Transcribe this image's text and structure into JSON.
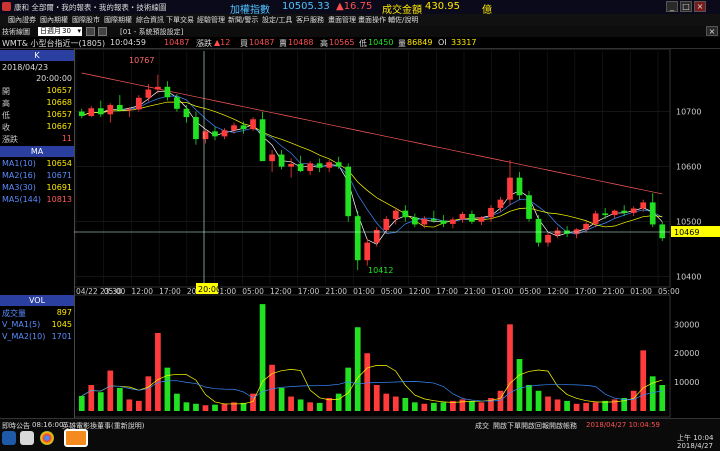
{
  "titlebar": {
    "app_title": "康和 全部爾・我的報表・我的報表・技術線圖",
    "index_label": "加權指數",
    "index_value": "10505.33",
    "index_change": "▲16.75",
    "amount_label": "成交金額",
    "amount_value": "430.95",
    "amount_unit": "億"
  },
  "menu": [
    "國內證券",
    "國內期權",
    "國際股市",
    "國際期權",
    "綜合資訊",
    "下單交易",
    "經驗管理",
    "新聞/警示",
    "設定/工具",
    "客戶服務",
    "畫面管理",
    "畫面操作",
    "輔佐/說明"
  ],
  "toolbar": {
    "label": "技術線圖",
    "period": "日週月",
    "minutes": "30",
    "description": "[01 - 系統預設設定]"
  },
  "quote": {
    "symbol": "WMT& 小型台指近一(1805)",
    "time": "10:04:59",
    "price": "10487",
    "change_label": "漲跌",
    "change": "▲12",
    "buy_label": "買",
    "buy": "10487",
    "sell_label": "賣",
    "sell": "10488",
    "high_label": "高",
    "high": "10565",
    "low_label": "低",
    "low": "10450",
    "volume_label": "量",
    "volume": "86849",
    "oi_label": "OI",
    "oi": "33317"
  },
  "kpanel": {
    "header": "K",
    "date": "2018/04/23",
    "time": "20:00:00",
    "rows": [
      {
        "k": "開",
        "v": "10657"
      },
      {
        "k": "高",
        "v": "10668"
      },
      {
        "k": "低",
        "v": "10657"
      },
      {
        "k": "收",
        "v": "10667"
      },
      {
        "k": "漲跌",
        "v": "11"
      }
    ]
  },
  "mapanel": {
    "header": "MA",
    "rows": [
      {
        "k": "MA1(10)",
        "v": "10654",
        "color": "#ffffff"
      },
      {
        "k": "MA2(16)",
        "v": "10671",
        "color": "#3a8bff"
      },
      {
        "k": "MA3(30)",
        "v": "10691",
        "color": "#ffff00"
      },
      {
        "k": "MA5(144)",
        "v": "10813",
        "color": "#ff5a5a"
      }
    ]
  },
  "volpanel": {
    "header": "VOL",
    "rows": [
      {
        "k": "成交量",
        "v": "897",
        "color": "#ffffff"
      },
      {
        "k": "V_MA1(5)",
        "v": "1045",
        "color": "#ffff00"
      },
      {
        "k": "V_MA2(10)",
        "v": "1701",
        "color": "#3a8bff"
      }
    ]
  },
  "chart_data": {
    "type": "candlestick",
    "price_axis": {
      "ticks": [
        "10700",
        "10600",
        "10500",
        "10400"
      ],
      "ylim": [
        10385,
        10810
      ]
    },
    "volume_axis": {
      "ticks": [
        "30000",
        "20000",
        "10000"
      ],
      "ylim": [
        0,
        36000
      ]
    },
    "current_price_tag": "10469",
    "max_label": "10767",
    "min_label": "10412",
    "cursor_time": "20:00",
    "x_ticks": [
      "04/22 23:30",
      "05:00",
      "12:00",
      "17:00",
      "20:00",
      "01:00",
      "05:00",
      "12:00",
      "17:00",
      "21:00",
      "01:00",
      "05:00",
      "12:00",
      "17:00",
      "21:00",
      "01:00",
      "05:00",
      "12:00",
      "17:00",
      "21:00",
      "01:00",
      "05:00"
    ],
    "candles": [
      [
        10700,
        10705,
        10688,
        10692
      ],
      [
        10692,
        10710,
        10690,
        10706
      ],
      [
        10706,
        10720,
        10690,
        10695
      ],
      [
        10695,
        10715,
        10680,
        10712
      ],
      [
        10712,
        10730,
        10700,
        10702
      ],
      [
        10702,
        10708,
        10690,
        10704
      ],
      [
        10704,
        10730,
        10700,
        10725
      ],
      [
        10725,
        10750,
        10718,
        10740
      ],
      [
        10740,
        10767,
        10733,
        10745
      ],
      [
        10745,
        10755,
        10720,
        10726
      ],
      [
        10726,
        10732,
        10700,
        10705
      ],
      [
        10705,
        10712,
        10680,
        10690
      ],
      [
        10690,
        10700,
        10640,
        10650
      ],
      [
        10650,
        10668,
        10642,
        10664
      ],
      [
        10664,
        10672,
        10648,
        10655
      ],
      [
        10655,
        10670,
        10650,
        10666
      ],
      [
        10666,
        10680,
        10660,
        10675
      ],
      [
        10675,
        10682,
        10660,
        10668
      ],
      [
        10668,
        10690,
        10665,
        10686
      ],
      [
        10686,
        10700,
        10640,
        10610
      ],
      [
        10610,
        10630,
        10590,
        10622
      ],
      [
        10622,
        10630,
        10595,
        10600
      ],
      [
        10600,
        10615,
        10580,
        10605
      ],
      [
        10605,
        10620,
        10590,
        10592
      ],
      [
        10592,
        10610,
        10585,
        10606
      ],
      [
        10606,
        10615,
        10590,
        10598
      ],
      [
        10598,
        10612,
        10590,
        10608
      ],
      [
        10608,
        10618,
        10596,
        10600
      ],
      [
        10600,
        10606,
        10500,
        10510
      ],
      [
        10510,
        10520,
        10412,
        10430
      ],
      [
        10430,
        10470,
        10420,
        10462
      ],
      [
        10462,
        10490,
        10455,
        10485
      ],
      [
        10485,
        10510,
        10478,
        10505
      ],
      [
        10505,
        10525,
        10495,
        10520
      ],
      [
        10520,
        10530,
        10500,
        10508
      ],
      [
        10508,
        10515,
        10490,
        10495
      ],
      [
        10495,
        10510,
        10488,
        10505
      ],
      [
        10505,
        10520,
        10498,
        10502
      ],
      [
        10502,
        10512,
        10490,
        10496
      ],
      [
        10496,
        10508,
        10488,
        10504
      ],
      [
        10504,
        10518,
        10498,
        10514
      ],
      [
        10514,
        10520,
        10496,
        10500
      ],
      [
        10500,
        10510,
        10494,
        10508
      ],
      [
        10508,
        10530,
        10500,
        10525
      ],
      [
        10525,
        10545,
        10518,
        10540
      ],
      [
        10540,
        10612,
        10530,
        10580
      ],
      [
        10580,
        10590,
        10540,
        10548
      ],
      [
        10548,
        10556,
        10500,
        10505
      ],
      [
        10505,
        10512,
        10455,
        10462
      ],
      [
        10462,
        10480,
        10455,
        10476
      ],
      [
        10476,
        10490,
        10470,
        10484
      ],
      [
        10484,
        10492,
        10472,
        10478
      ],
      [
        10478,
        10488,
        10470,
        10486
      ],
      [
        10486,
        10500,
        10480,
        10496
      ],
      [
        10496,
        10520,
        10490,
        10515
      ],
      [
        10515,
        10525,
        10505,
        10512
      ],
      [
        10512,
        10522,
        10506,
        10520
      ],
      [
        10520,
        10530,
        10510,
        10516
      ],
      [
        10516,
        10528,
        10510,
        10524
      ],
      [
        10524,
        10540,
        10518,
        10535
      ],
      [
        10535,
        10552,
        10490,
        10495
      ],
      [
        10495,
        10500,
        10465,
        10470
      ]
    ],
    "volumes": [
      5200,
      9000,
      6500,
      14000,
      8000,
      4000,
      3500,
      12000,
      27000,
      15000,
      6000,
      3000,
      2500,
      2000,
      2200,
      2500,
      3000,
      2800,
      6000,
      37000,
      16000,
      8000,
      5000,
      4000,
      3000,
      2800,
      4500,
      6000,
      15000,
      29000,
      20000,
      9000,
      6000,
      5000,
      4500,
      3000,
      2500,
      2800,
      3000,
      3500,
      4000,
      3500,
      3000,
      4500,
      7000,
      30000,
      18000,
      9000,
      7000,
      5000,
      4000,
      3500,
      2500,
      2800,
      3000,
      3500,
      4000,
      4500,
      7000,
      21000,
      12000,
      9000
    ]
  },
  "statusbar": {
    "bulletin_label": "即時公告",
    "bulletin_time": "08:16:00",
    "bulletin_text": "英雄電影換董事(重新說明)",
    "buttons": [
      "成交",
      "開啟下單",
      "開啟回報",
      "開啟帳務"
    ],
    "clock": "2018/04/27 10:04:59",
    "sys_time": "上午 10:04",
    "sys_date": "2018/4/27"
  },
  "colors": {
    "up": "#ff3b3b",
    "down": "#22e022",
    "ma10": "#ffffff",
    "ma16": "#3a8bff",
    "ma30": "#ffff00",
    "ma144": "#ff5a5a",
    "panel_header": "#2a3fa0"
  }
}
